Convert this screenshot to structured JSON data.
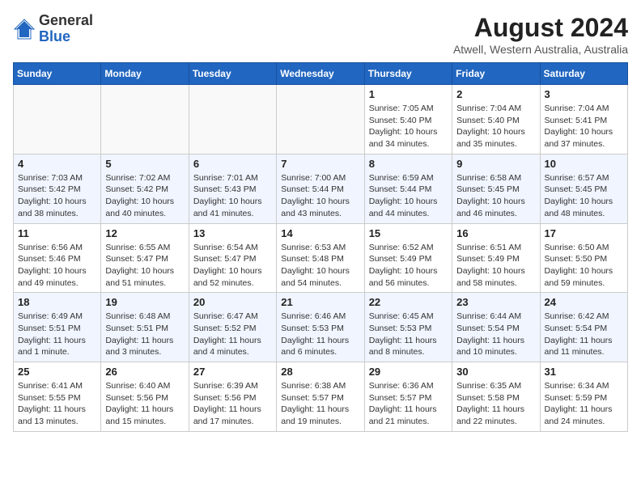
{
  "header": {
    "logo_general": "General",
    "logo_blue": "Blue",
    "month_year": "August 2024",
    "location": "Atwell, Western Australia, Australia"
  },
  "weekdays": [
    "Sunday",
    "Monday",
    "Tuesday",
    "Wednesday",
    "Thursday",
    "Friday",
    "Saturday"
  ],
  "weeks": [
    [
      {
        "day": "",
        "info": ""
      },
      {
        "day": "",
        "info": ""
      },
      {
        "day": "",
        "info": ""
      },
      {
        "day": "",
        "info": ""
      },
      {
        "day": "1",
        "info": "Sunrise: 7:05 AM\nSunset: 5:40 PM\nDaylight: 10 hours\nand 34 minutes."
      },
      {
        "day": "2",
        "info": "Sunrise: 7:04 AM\nSunset: 5:40 PM\nDaylight: 10 hours\nand 35 minutes."
      },
      {
        "day": "3",
        "info": "Sunrise: 7:04 AM\nSunset: 5:41 PM\nDaylight: 10 hours\nand 37 minutes."
      }
    ],
    [
      {
        "day": "4",
        "info": "Sunrise: 7:03 AM\nSunset: 5:42 PM\nDaylight: 10 hours\nand 38 minutes."
      },
      {
        "day": "5",
        "info": "Sunrise: 7:02 AM\nSunset: 5:42 PM\nDaylight: 10 hours\nand 40 minutes."
      },
      {
        "day": "6",
        "info": "Sunrise: 7:01 AM\nSunset: 5:43 PM\nDaylight: 10 hours\nand 41 minutes."
      },
      {
        "day": "7",
        "info": "Sunrise: 7:00 AM\nSunset: 5:44 PM\nDaylight: 10 hours\nand 43 minutes."
      },
      {
        "day": "8",
        "info": "Sunrise: 6:59 AM\nSunset: 5:44 PM\nDaylight: 10 hours\nand 44 minutes."
      },
      {
        "day": "9",
        "info": "Sunrise: 6:58 AM\nSunset: 5:45 PM\nDaylight: 10 hours\nand 46 minutes."
      },
      {
        "day": "10",
        "info": "Sunrise: 6:57 AM\nSunset: 5:45 PM\nDaylight: 10 hours\nand 48 minutes."
      }
    ],
    [
      {
        "day": "11",
        "info": "Sunrise: 6:56 AM\nSunset: 5:46 PM\nDaylight: 10 hours\nand 49 minutes."
      },
      {
        "day": "12",
        "info": "Sunrise: 6:55 AM\nSunset: 5:47 PM\nDaylight: 10 hours\nand 51 minutes."
      },
      {
        "day": "13",
        "info": "Sunrise: 6:54 AM\nSunset: 5:47 PM\nDaylight: 10 hours\nand 52 minutes."
      },
      {
        "day": "14",
        "info": "Sunrise: 6:53 AM\nSunset: 5:48 PM\nDaylight: 10 hours\nand 54 minutes."
      },
      {
        "day": "15",
        "info": "Sunrise: 6:52 AM\nSunset: 5:49 PM\nDaylight: 10 hours\nand 56 minutes."
      },
      {
        "day": "16",
        "info": "Sunrise: 6:51 AM\nSunset: 5:49 PM\nDaylight: 10 hours\nand 58 minutes."
      },
      {
        "day": "17",
        "info": "Sunrise: 6:50 AM\nSunset: 5:50 PM\nDaylight: 10 hours\nand 59 minutes."
      }
    ],
    [
      {
        "day": "18",
        "info": "Sunrise: 6:49 AM\nSunset: 5:51 PM\nDaylight: 11 hours\nand 1 minute."
      },
      {
        "day": "19",
        "info": "Sunrise: 6:48 AM\nSunset: 5:51 PM\nDaylight: 11 hours\nand 3 minutes."
      },
      {
        "day": "20",
        "info": "Sunrise: 6:47 AM\nSunset: 5:52 PM\nDaylight: 11 hours\nand 4 minutes."
      },
      {
        "day": "21",
        "info": "Sunrise: 6:46 AM\nSunset: 5:53 PM\nDaylight: 11 hours\nand 6 minutes."
      },
      {
        "day": "22",
        "info": "Sunrise: 6:45 AM\nSunset: 5:53 PM\nDaylight: 11 hours\nand 8 minutes."
      },
      {
        "day": "23",
        "info": "Sunrise: 6:44 AM\nSunset: 5:54 PM\nDaylight: 11 hours\nand 10 minutes."
      },
      {
        "day": "24",
        "info": "Sunrise: 6:42 AM\nSunset: 5:54 PM\nDaylight: 11 hours\nand 11 minutes."
      }
    ],
    [
      {
        "day": "25",
        "info": "Sunrise: 6:41 AM\nSunset: 5:55 PM\nDaylight: 11 hours\nand 13 minutes."
      },
      {
        "day": "26",
        "info": "Sunrise: 6:40 AM\nSunset: 5:56 PM\nDaylight: 11 hours\nand 15 minutes."
      },
      {
        "day": "27",
        "info": "Sunrise: 6:39 AM\nSunset: 5:56 PM\nDaylight: 11 hours\nand 17 minutes."
      },
      {
        "day": "28",
        "info": "Sunrise: 6:38 AM\nSunset: 5:57 PM\nDaylight: 11 hours\nand 19 minutes."
      },
      {
        "day": "29",
        "info": "Sunrise: 6:36 AM\nSunset: 5:57 PM\nDaylight: 11 hours\nand 21 minutes."
      },
      {
        "day": "30",
        "info": "Sunrise: 6:35 AM\nSunset: 5:58 PM\nDaylight: 11 hours\nand 22 minutes."
      },
      {
        "day": "31",
        "info": "Sunrise: 6:34 AM\nSunset: 5:59 PM\nDaylight: 11 hours\nand 24 minutes."
      }
    ]
  ]
}
